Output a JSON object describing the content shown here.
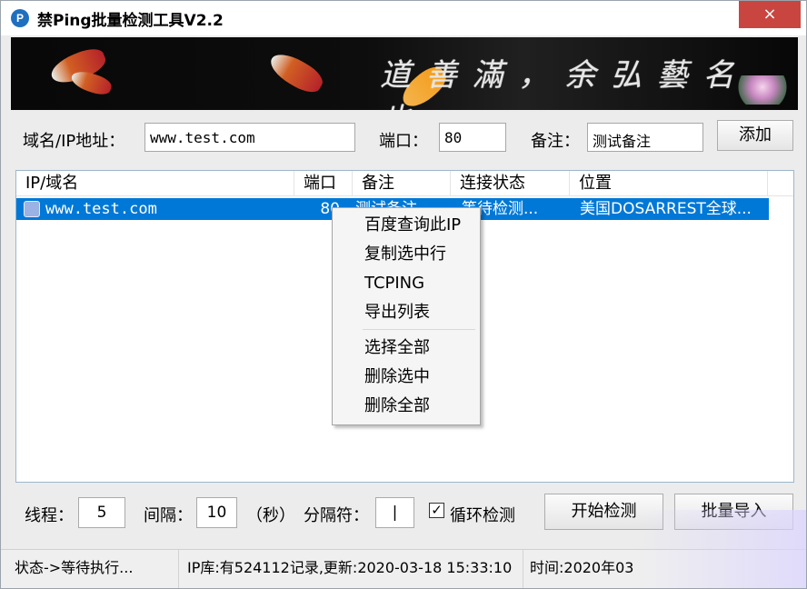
{
  "window": {
    "title": "禁Ping批量检测工具V2.2",
    "close_label": "×",
    "app_icon_label": "P"
  },
  "banner": {
    "calligraphy": "道  善  滿  ，  余  弘  藝  名，  也"
  },
  "form": {
    "domain_label": "域名/IP地址：",
    "domain_value": "www.test.com",
    "port_label": "端口：",
    "port_value": "80",
    "note_label": "备注：",
    "note_value": "测试备注",
    "add_button": "添加"
  },
  "table": {
    "columns": [
      "IP/域名",
      "端口",
      "备注",
      "连接状态",
      "位置"
    ],
    "rows": [
      {
        "host": "www.test.com",
        "port": "80",
        "note": "测试备注",
        "status": "等待检测...",
        "location": "美国DOSARREST全球..."
      }
    ]
  },
  "context_menu": {
    "items": [
      "百度查询此IP",
      "复制选中行",
      "TCPING",
      "导出列表",
      "选择全部",
      "删除选中",
      "删除全部"
    ]
  },
  "controls": {
    "threads_label": "线程：",
    "threads_value": "5",
    "interval_label": "间隔：",
    "interval_value": "10",
    "seconds_label": "（秒）",
    "separator_label": "分隔符：",
    "separator_value": "|",
    "loop_check_label": "循环检测",
    "loop_checked": true,
    "start_button": "开始检测",
    "import_button": "批量导入"
  },
  "status_bar": {
    "state": "状态->等待执行...",
    "ip_db": "IP库:有524112记录,更新:2020-03-18 15:33:10",
    "time": "时间:2020年03"
  },
  "colors": {
    "selection": "#0078d7",
    "close_button": "#c8463f",
    "window_background": "#ececec"
  }
}
